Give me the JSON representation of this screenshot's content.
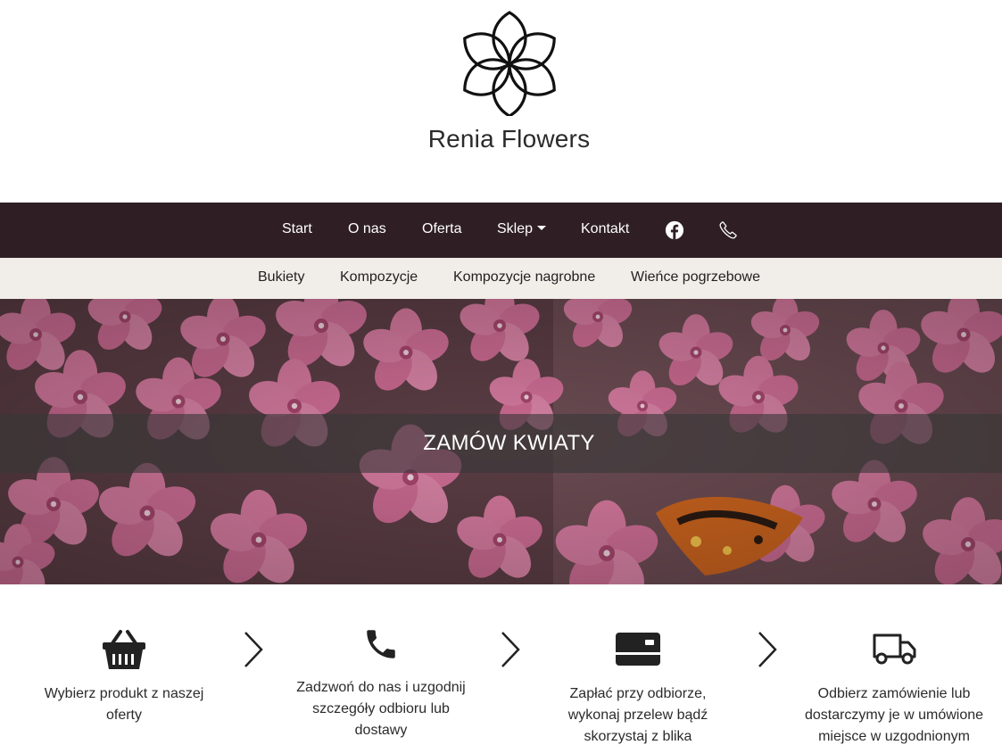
{
  "brand": {
    "name": "Renia Flowers",
    "logo_icon": "flower-logo-icon"
  },
  "main_nav": {
    "items": [
      {
        "label": "Start"
      },
      {
        "label": "O nas"
      },
      {
        "label": "Oferta"
      },
      {
        "label": "Sklep",
        "dropdown": true
      },
      {
        "label": "Kontakt"
      }
    ],
    "icons": [
      "facebook-icon",
      "phone-icon"
    ],
    "background": "#2f1f24"
  },
  "sub_nav": {
    "items": [
      {
        "label": "Bukiety"
      },
      {
        "label": "Kompozycje"
      },
      {
        "label": "Kompozycje nagrobne"
      },
      {
        "label": "Wieńce pogrzebowe"
      }
    ],
    "background": "#f1eee9"
  },
  "hero": {
    "title": "ZAMÓW KWIATY"
  },
  "steps": [
    {
      "icon": "basket-icon",
      "text_lines": [
        "Wybierz produkt z naszej",
        "oferty"
      ]
    },
    {
      "icon": "phone-icon",
      "text_lines": [
        "Zadzwoń do nas i uzgodnij",
        "szczegóły odbioru lub",
        "dostawy"
      ]
    },
    {
      "icon": "credit-card-icon",
      "text_lines": [
        "Zapłać przy odbiorze,",
        "wykonaj przelew bądź",
        "skorzystaj z blika"
      ]
    },
    {
      "icon": "delivery-truck-icon",
      "text_lines": [
        "Odbierz zamówienie lub",
        "dostarczymy je w umówione",
        "miejsce w uzgodnionym"
      ]
    }
  ]
}
